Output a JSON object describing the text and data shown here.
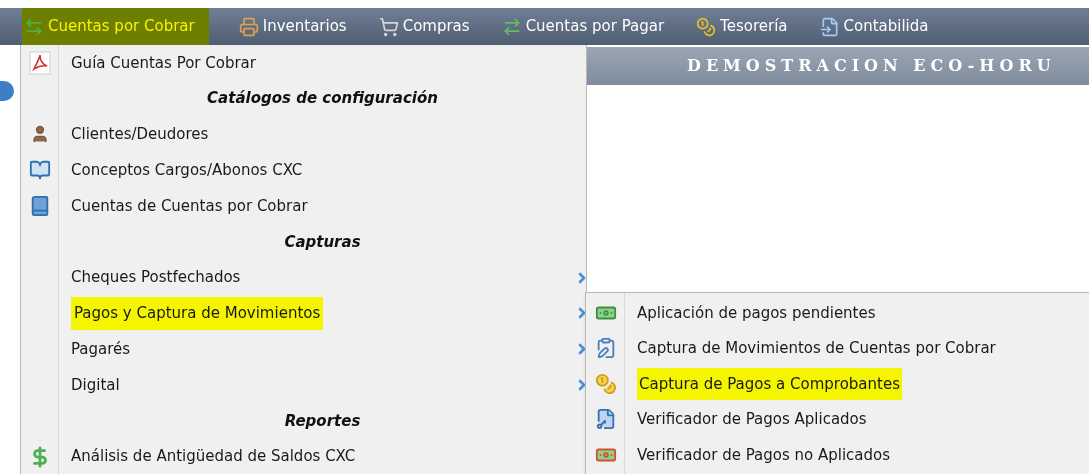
{
  "menu_bar": [
    {
      "label": "Cuentas por Cobrar",
      "selected": true
    },
    {
      "label": "Inventarios",
      "selected": false
    },
    {
      "label": "Compras",
      "selected": false
    },
    {
      "label": "Cuentas por Pagar",
      "selected": false
    },
    {
      "label": "Tesorería",
      "selected": false
    },
    {
      "label": "Contabilida",
      "selected": false
    }
  ],
  "header": {
    "title": "DEMOSTRACION ECO-HORU"
  },
  "dropdown": [
    {
      "kind": "item",
      "label": "Guía Cuentas Por Cobrar",
      "highlighted": false,
      "has_submenu": false
    },
    {
      "kind": "section",
      "label": "Catálogos de configuración"
    },
    {
      "kind": "item",
      "label": "Clientes/Deudores",
      "highlighted": false,
      "has_submenu": false
    },
    {
      "kind": "item",
      "label": "Conceptos Cargos/Abonos CXC",
      "highlighted": false,
      "has_submenu": false
    },
    {
      "kind": "item",
      "label": "Cuentas de Cuentas por Cobrar",
      "highlighted": false,
      "has_submenu": false
    },
    {
      "kind": "section",
      "label": "Capturas"
    },
    {
      "kind": "item",
      "label": "Cheques Postfechados",
      "highlighted": false,
      "has_submenu": true
    },
    {
      "kind": "item",
      "label": "Pagos y Captura de Movimientos",
      "highlighted": true,
      "has_submenu": true
    },
    {
      "kind": "item",
      "label": "Pagarés",
      "highlighted": false,
      "has_submenu": true
    },
    {
      "kind": "item",
      "label": "Digital",
      "highlighted": false,
      "has_submenu": true
    },
    {
      "kind": "section",
      "label": "Reportes"
    },
    {
      "kind": "item",
      "label": "Análisis de Antigüedad de Saldos CXC",
      "highlighted": false,
      "has_submenu": false
    }
  ],
  "submenu": [
    {
      "label": "Aplicación de pagos pendientes",
      "highlighted": false
    },
    {
      "label": "Captura de Movimientos de Cuentas por Cobrar",
      "highlighted": false
    },
    {
      "label": "Captura de Pagos a Comprobantes",
      "highlighted": true
    },
    {
      "label": "Verificador de Pagos Aplicados",
      "highlighted": false
    },
    {
      "label": "Verificador de Pagos no Aplicados",
      "highlighted": false
    }
  ]
}
